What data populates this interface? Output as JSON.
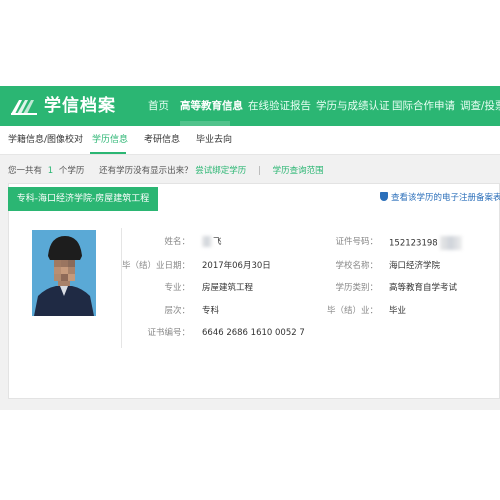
{
  "header": {
    "brand": "学信档案",
    "nav": [
      {
        "label": "首页"
      },
      {
        "label": "高等教育信息"
      },
      {
        "label": "在线验证报告"
      },
      {
        "label": "学历与成绩认证"
      },
      {
        "label": "国际合作申请"
      },
      {
        "label": "调查/投票"
      }
    ]
  },
  "subnav": {
    "items": [
      {
        "label": "学籍信息/图像校对"
      },
      {
        "label": "学历信息"
      },
      {
        "label": "考研信息"
      },
      {
        "label": "毕业去向"
      }
    ]
  },
  "info": {
    "prefix": "您一共有",
    "count": "1",
    "suffix": "个学历",
    "question": "还有学历没有显示出来？",
    "bind_link": "尝试绑定学历",
    "sep": "|",
    "scope_link": "学历查询范围"
  },
  "record": {
    "tab_title": "专科-海口经济学院-房屋建筑工程",
    "verify_link": "查看该学历的电子注册备案表",
    "fields": {
      "name_label": "姓名：",
      "name_value": "飞",
      "cert_label": "证件号码：",
      "cert_value": "152123198",
      "grad_date_label": "毕（结）业日期：",
      "grad_date_value": "2017年06月30日",
      "school_label": "学校名称：",
      "school_value": "海口经济学院",
      "major_label": "专业：",
      "major_value": "房屋建筑工程",
      "edu_type_label": "学历类别：",
      "edu_type_value": "高等教育自学考试",
      "level_label": "层次：",
      "level_value": "专科",
      "status_label": "毕（结）业：",
      "status_value": "毕业",
      "certno_label": "证书编号：",
      "certno_value": "6646 2686 1610 0052 7"
    }
  },
  "colors": {
    "brand_green": "#2bb673",
    "link_blue": "#2b6fba",
    "page_gray": "#f1f1f1"
  }
}
